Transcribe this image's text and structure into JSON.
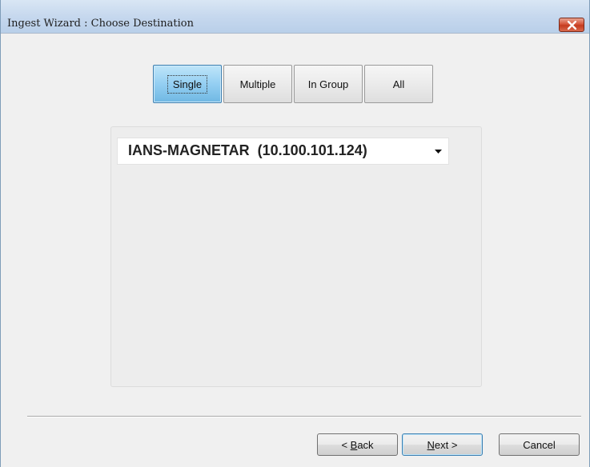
{
  "window": {
    "title": "Ingest Wizard : Choose Destination"
  },
  "mode_selector": {
    "options": [
      "Single",
      "Multiple",
      "In Group",
      "All"
    ],
    "selected": "Single"
  },
  "destination": {
    "selected_value": "IANS-MAGNETAR  (10.100.101.124)"
  },
  "footer": {
    "back_prefix": "< ",
    "back_mnemonic": "B",
    "back_rest": "ack",
    "next_mnemonic": "N",
    "next_rest": "ext >",
    "cancel_label": "Cancel"
  },
  "colors": {
    "selected_accent": "#94cff2",
    "close_button": "#d5553a"
  },
  "icons": {
    "close": "close-icon",
    "dropdown": "chevron-down-icon"
  }
}
